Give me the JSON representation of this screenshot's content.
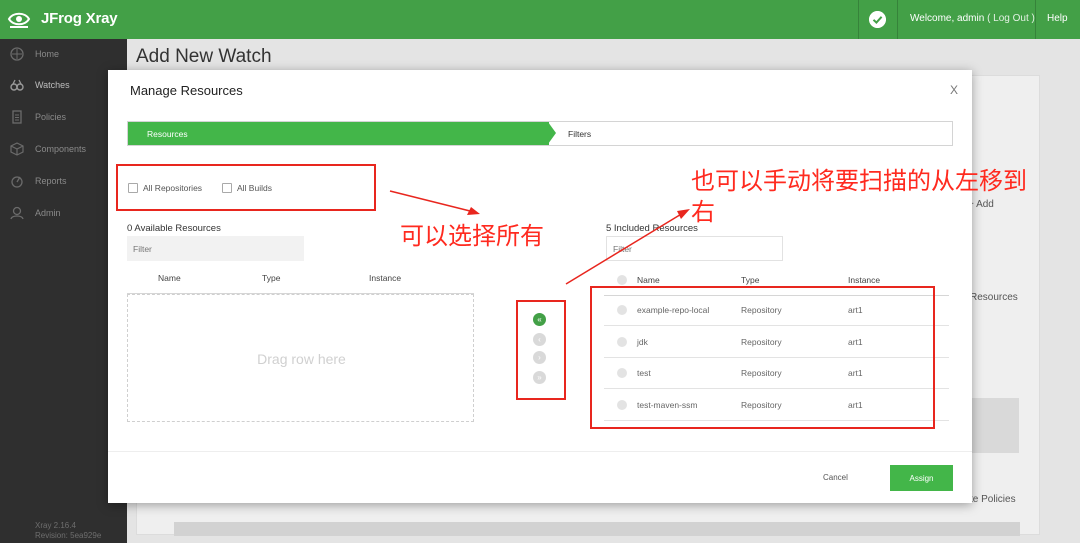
{
  "app": {
    "title": "JFrog Xray"
  },
  "header": {
    "welcome_prefix": "Welcome, admin",
    "logout": "( Log Out )",
    "help": "Help"
  },
  "sidebar": {
    "items": [
      {
        "label": "Home",
        "icon": "home-icon"
      },
      {
        "label": "Watches",
        "icon": "binoculars-icon"
      },
      {
        "label": "Policies",
        "icon": "document-icon"
      },
      {
        "label": "Components",
        "icon": "cube-icon"
      },
      {
        "label": "Reports",
        "icon": "reports-icon"
      },
      {
        "label": "Admin",
        "icon": "admin-icon"
      }
    ],
    "version_line1": "Xray 2.16.4",
    "version_line2": "Revision: 5ea929e"
  },
  "background": {
    "page_title": "Add New Watch",
    "add_label": "+ Add",
    "resources_label": "Resources",
    "policies_label": "te Policies"
  },
  "modal": {
    "title": "Manage Resources",
    "close": "X",
    "steps": {
      "active": "Resources",
      "next": "Filters"
    },
    "checkboxes": {
      "all_repositories": "All Repositories",
      "all_builds": "All Builds"
    },
    "available": {
      "title": "0 Available Resources",
      "filter_placeholder": "Filter",
      "columns": [
        "Name",
        "Type",
        "Instance"
      ],
      "drop_text": "Drag row here"
    },
    "move_buttons": [
      "«",
      "‹",
      "›",
      "»"
    ],
    "included": {
      "title": "5 Included Resources",
      "filter_placeholder": "Filter",
      "columns": [
        "Name",
        "Type",
        "Instance"
      ],
      "rows": [
        {
          "name": "example-repo-local",
          "type": "Repository",
          "instance": "art1"
        },
        {
          "name": "jdk",
          "type": "Repository",
          "instance": "art1"
        },
        {
          "name": "test",
          "type": "Repository",
          "instance": "art1"
        },
        {
          "name": "test-maven-ssm",
          "type": "Repository",
          "instance": "art1"
        }
      ]
    },
    "cancel": "Cancel",
    "assign": "Assign"
  },
  "annotations": {
    "select_all": "可以选择所有",
    "move_line1": "也可以手动将要扫描的从左移到",
    "move_line2": "右",
    "color": "#ff2a1f"
  },
  "colors": {
    "brand_green": "#43a047",
    "step_green": "#43b649",
    "sidebar_bg": "#2f2f2f"
  }
}
